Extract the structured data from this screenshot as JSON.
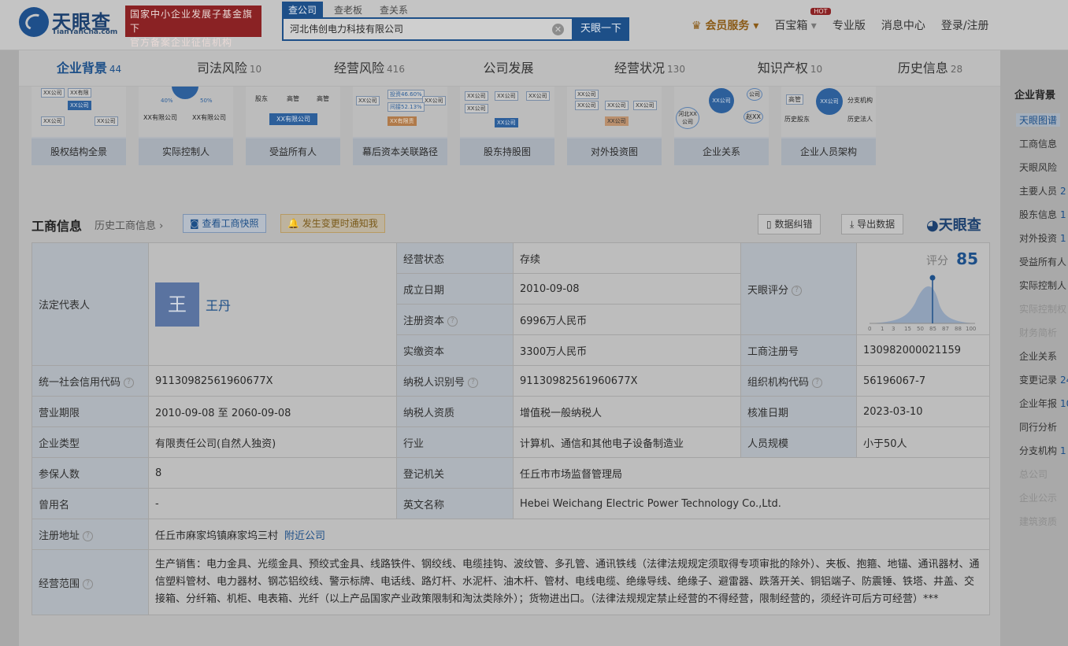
{
  "header": {
    "logo_text": "天眼查",
    "logo_sub": "TianYanCha.com",
    "slogan_line1": "国家中小企业发展子基金旗下",
    "slogan_line2": "官方备案企业征信机构",
    "search_tabs": [
      "查公司",
      "查老板",
      "查关系"
    ],
    "search_value": "河北伟创电力科技有限公司",
    "search_button": "天眼一下",
    "nav": {
      "vip": "会员服务",
      "treasure": "百宝箱",
      "hot": "HOT",
      "pro": "专业版",
      "messages": "消息中心",
      "login": "登录/注册"
    }
  },
  "tabs": [
    {
      "label": "企业背景",
      "count": "44"
    },
    {
      "label": "司法风险",
      "count": "10"
    },
    {
      "label": "经营风险",
      "count": "416"
    },
    {
      "label": "公司发展",
      "count": ""
    },
    {
      "label": "经营状况",
      "count": "130"
    },
    {
      "label": "知识产权",
      "count": "10"
    },
    {
      "label": "历史信息",
      "count": "28"
    }
  ],
  "cards": [
    {
      "label": "股权结构全景",
      "nodes": [
        "XX公司",
        "XX有限",
        "XX公司",
        "XX公司",
        "XX公司",
        "XX公司"
      ]
    },
    {
      "label": "实际控制人",
      "nodes": [
        "40%",
        "50%",
        "XX有限公司",
        "XX有限公司"
      ]
    },
    {
      "label": "受益所有人",
      "nodes": [
        "股东",
        "高管",
        "高管",
        "XX有限公司"
      ]
    },
    {
      "label": "幕后资本关联路径",
      "nodes": [
        "XX公司",
        "投资46.60%",
        "XX公司",
        "间接52.13%",
        "XX有限责"
      ]
    },
    {
      "label": "股东持股图",
      "nodes": [
        "XX公司",
        "XX公司",
        "XX公司",
        "XX公司",
        "XX公司"
      ]
    },
    {
      "label": "对外投资图",
      "nodes": [
        "XX公司",
        "XX公司",
        "XX公司",
        "XX公司",
        "XX公司"
      ]
    },
    {
      "label": "企业关系",
      "nodes": [
        "XX公司",
        "公司",
        "河北XX公司",
        "赵XX"
      ]
    },
    {
      "label": "企业人员架构",
      "nodes": [
        "高管",
        "XX公司",
        "分支机构",
        "历史股东",
        "历史法人"
      ]
    }
  ],
  "section": {
    "title": "工商信息",
    "history": "历史工商信息",
    "snapshot": "查看工商快照",
    "notify": "发生变更时通知我",
    "correct": "数据纠错",
    "export": "导出数据",
    "brand": "天眼查"
  },
  "info": {
    "legal_rep_label": "法定代表人",
    "legal_rep_avatar": "王",
    "legal_rep_name": "王丹",
    "status_label": "经营状态",
    "status": "存续",
    "found_label": "成立日期",
    "found": "2010-09-08",
    "reg_cap_label": "注册资本",
    "reg_cap": "6996万人民币",
    "paid_cap_label": "实缴资本",
    "paid_cap": "3300万人民币",
    "score_label": "天眼评分",
    "score_word": "评分",
    "score": "85",
    "score_ticks": [
      "0",
      "1",
      "3",
      "15",
      "50",
      "85",
      "87",
      "88",
      "100"
    ],
    "bizreg_label": "工商注册号",
    "bizreg": "130982000021159",
    "credit_label": "统一社会信用代码",
    "credit": "91130982561960677X",
    "taxid_label": "纳税人识别号",
    "taxid": "91130982561960677X",
    "org_label": "组织机构代码",
    "org": "56196067-7",
    "term_label": "营业期限",
    "term": "2010-09-08 至 2060-09-08",
    "taxtype_label": "纳税人资质",
    "taxtype": "增值税一般纳税人",
    "approve_label": "核准日期",
    "approve": "2023-03-10",
    "type_label": "企业类型",
    "type": "有限责任公司(自然人独资)",
    "industry_label": "行业",
    "industry": "计算机、通信和其他电子设备制造业",
    "staff_label": "人员规模",
    "staff": "小于50人",
    "insured_label": "参保人数",
    "insured": "8",
    "authority_label": "登记机关",
    "authority": "任丘市市场监督管理局",
    "former_label": "曾用名",
    "former": "-",
    "en_label": "英文名称",
    "en": "Hebei Weichang Electric Power Technology Co.,Ltd.",
    "addr_label": "注册地址",
    "addr": "任丘市麻家坞镇麻家坞三村",
    "nearby": "附近公司",
    "scope_label": "经营范围",
    "scope": "生产销售：电力金具、光缆金具、预绞式金具、线路铁件、钢绞线、电缆挂钩、波纹管、多孔管、通讯铁线（法律法规规定须取得专项审批的除外）、夹板、抱箍、地锚、通讯器材、通信塑料管材、电力器材、钢芯铝绞线、警示标牌、电话线、路灯杆、水泥杆、油木杆、管材、电线电缆、绝缘导线、绝缘子、避雷器、跌落开关、铜铝端子、防震锤、铁塔、井盖、交接箱、分纤箱、机柜、电表箱、光纤（以上产品国家产业政策限制和淘汰类除外）；货物进出口。（法律法规规定禁止经营的不得经营，限制经营的，须经许可后方可经营）***"
  },
  "sidebar": {
    "title": "企业背景",
    "items": [
      {
        "label": "天眼图谱",
        "count": ""
      },
      {
        "label": "工商信息",
        "count": ""
      },
      {
        "label": "天眼风险",
        "count": ""
      },
      {
        "label": "主要人员",
        "count": "2"
      },
      {
        "label": "股东信息",
        "count": "1"
      },
      {
        "label": "对外投资",
        "count": "1"
      },
      {
        "label": "受益所有人",
        "count": ""
      },
      {
        "label": "实际控制人",
        "count": ""
      },
      {
        "label": "实际控制权",
        "count": ""
      },
      {
        "label": "财务简析",
        "count": ""
      },
      {
        "label": "企业关系",
        "count": ""
      },
      {
        "label": "变更记录",
        "count": "24"
      },
      {
        "label": "企业年报",
        "count": "10"
      },
      {
        "label": "同行分析",
        "count": ""
      },
      {
        "label": "分支机构",
        "count": "1"
      },
      {
        "label": "总公司",
        "count": ""
      },
      {
        "label": "企业公示",
        "count": ""
      },
      {
        "label": "建筑资质",
        "count": ""
      }
    ]
  },
  "colors": {
    "accent": "#1d4f88",
    "brand_red": "#8a2224"
  }
}
